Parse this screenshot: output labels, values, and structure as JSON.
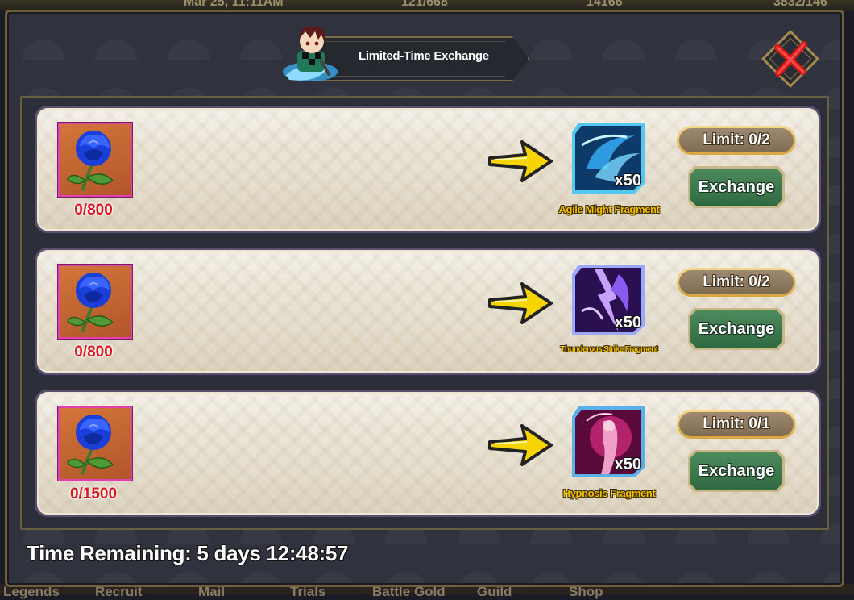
{
  "background_hud": {
    "top_text": "Mar 25, 11:11AM",
    "top_counter_1": "121/668",
    "top_counter_2": "14166",
    "top_counter_3": "3832/146",
    "bottom_tabs": [
      "Legends",
      "Recruit",
      "Mail",
      "Trials",
      "Battle Gold",
      "Guild",
      "Shop"
    ]
  },
  "dialog": {
    "title": "Limited-Time Exchange",
    "close_icon": "close-x-icon"
  },
  "exchange_rows": [
    {
      "cost_item_icon": "blue-rose-icon",
      "cost_progress": "0/800",
      "reward_icon": "agile-might-fragment-icon",
      "reward_qty": "x50",
      "reward_name": "Agile Might Fragment",
      "limit": "Limit: 0/2",
      "button_label": "Exchange"
    },
    {
      "cost_item_icon": "blue-rose-icon",
      "cost_progress": "0/800",
      "reward_icon": "thunderous-strike-fragment-icon",
      "reward_qty": "x50",
      "reward_name": "Thunderous Strike Fragment",
      "limit": "Limit: 0/2",
      "button_label": "Exchange"
    },
    {
      "cost_item_icon": "blue-rose-icon",
      "cost_progress": "0/1500",
      "reward_icon": "hypnosis-fragment-icon",
      "reward_qty": "x50",
      "reward_name": "Hypnosis Fragment",
      "limit": "Limit: 0/1",
      "button_label": "Exchange"
    }
  ],
  "footer": {
    "time_remaining": "Time Remaining: 5 days 12:48:57"
  },
  "colors": {
    "cost_text": "#e0141c",
    "reward_name_text": "#f0c000",
    "exchange_button": "#3a7a4e",
    "frame_gold": "#8a7750"
  }
}
